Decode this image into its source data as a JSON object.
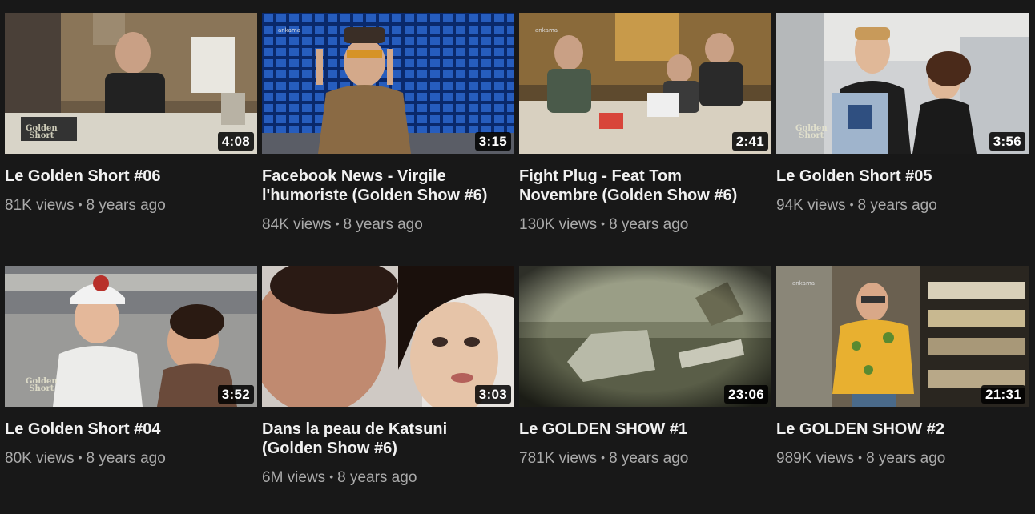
{
  "videos": [
    {
      "title": "Le Golden Short #06",
      "views": "81K views",
      "age": "8 years ago",
      "duration": "4:08",
      "thumbnail_icon": "office-phone-thumbnail"
    },
    {
      "title": "Facebook News - Virgile l'humoriste (Golden Show #6)",
      "views": "84K views",
      "age": "8 years ago",
      "duration": "3:15",
      "thumbnail_icon": "presenter-thumbnail"
    },
    {
      "title": "Fight Plug - Feat Tom Novembre (Golden Show #6)",
      "views": "130K views",
      "age": "8 years ago",
      "duration": "2:41",
      "thumbnail_icon": "office-group-thumbnail"
    },
    {
      "title": "Le Golden Short #05",
      "views": "94K views",
      "age": "8 years ago",
      "duration": "3:56",
      "thumbnail_icon": "couple-talk-thumbnail"
    },
    {
      "title": "Le Golden Short #04",
      "views": "80K views",
      "age": "8 years ago",
      "duration": "3:52",
      "thumbnail_icon": "two-men-thumbnail"
    },
    {
      "title": "Dans la peau de Katsuni (Golden Show #6)",
      "views": "6M views",
      "age": "8 years ago",
      "duration": "3:03",
      "thumbnail_icon": "couple-closeup-thumbnail"
    },
    {
      "title": "Le GOLDEN SHOW #1",
      "views": "781K views",
      "age": "8 years ago",
      "duration": "23:06",
      "thumbnail_icon": "wreckage-thumbnail"
    },
    {
      "title": "Le GOLDEN SHOW #2",
      "views": "989K views",
      "age": "8 years ago",
      "duration": "21:31",
      "thumbnail_icon": "man-on-phone-thumbnail"
    }
  ],
  "separator": "•",
  "logo_text": {
    "golden": "Golden",
    "short": "Short",
    "ankama": "ankama"
  }
}
